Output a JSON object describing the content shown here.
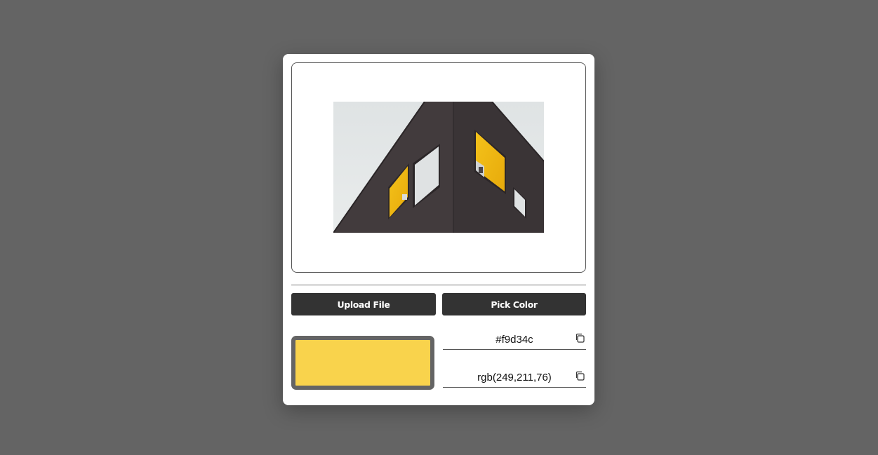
{
  "preview": {
    "image_alt": "Building corner with yellow windows"
  },
  "actions": {
    "upload_label": "Upload File",
    "pick_label": "Pick Color"
  },
  "color": {
    "swatch_hex": "#f9d34c",
    "hex": "#f9d34c",
    "rgb": "rgb(249,211,76)"
  },
  "icons": {
    "hex_copy": "copy-icon",
    "rgb_copy": "copy-icon"
  }
}
